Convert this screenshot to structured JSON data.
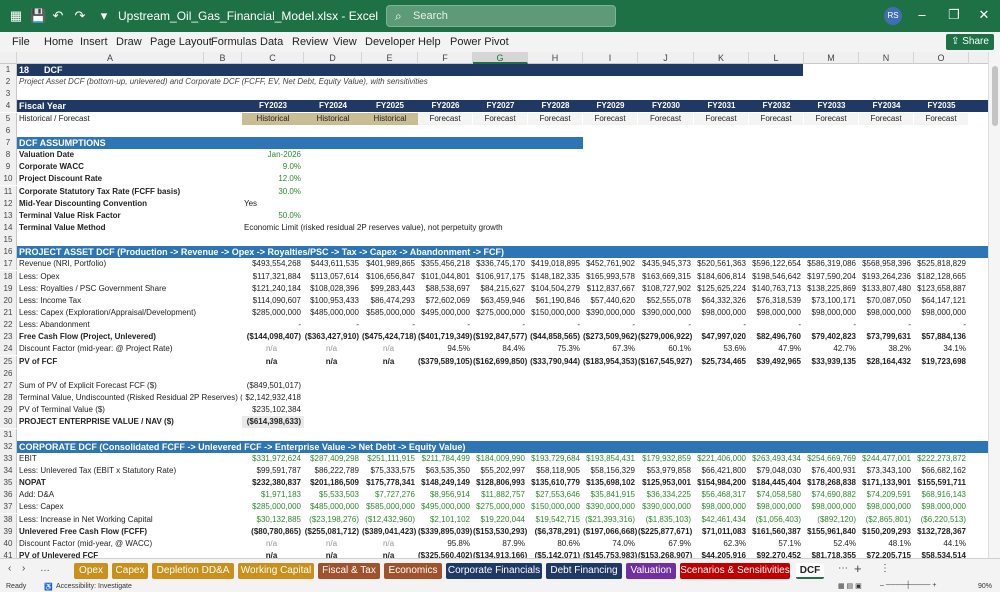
{
  "window": {
    "title": "Upstream_Oil_Gas_Financial_Model.xlsx - Excel",
    "search_placeholder": "Search",
    "avatar_initials": "RS",
    "accent": "#1e7145"
  },
  "menu": [
    "File",
    "Home",
    "Insert",
    "Draw",
    "Page Layout",
    "Formulas",
    "Data",
    "Review",
    "View",
    "Developer",
    "Help",
    "Power Pivot"
  ],
  "share_label": "Share",
  "columns": [
    "A",
    "B",
    "C",
    "D",
    "E",
    "F",
    "G",
    "H",
    "I",
    "J",
    "K",
    "L",
    "M",
    "N",
    "O"
  ],
  "sheet": {
    "title_num": "18",
    "title": "DCF",
    "subtitle": "Project Asset DCF (bottom-up, unlevered) and Corporate DCF (FCFF, EV, Net Debt, Equity Value), with sensitivities",
    "fiscal_year_label": "Fiscal Year",
    "hf_label": "Historical / Forecast",
    "years": [
      "FY2023",
      "FY2024",
      "FY2025",
      "FY2026",
      "FY2027",
      "FY2028",
      "FY2029",
      "FY2030",
      "FY2031",
      "FY2032",
      "FY2033",
      "FY2034",
      "FY2035"
    ],
    "hf": [
      "Historical",
      "Historical",
      "Historical",
      "Forecast",
      "Forecast",
      "Forecast",
      "Forecast",
      "Forecast",
      "Forecast",
      "Forecast",
      "Forecast",
      "Forecast",
      "Forecast"
    ],
    "assumptions_header": "DCF ASSUMPTIONS",
    "assumptions": [
      {
        "label": "Valuation Date",
        "value": "Jan-2026"
      },
      {
        "label": "Corporate WACC",
        "value": "9.0%"
      },
      {
        "label": "Project Discount Rate",
        "value": "12.0%"
      },
      {
        "label": "Corporate Statutory Tax Rate (FCFF basis)",
        "value": "30.0%"
      },
      {
        "label": "Mid-Year Discounting Convention",
        "value": "Yes"
      },
      {
        "label": "Terminal Value Risk Factor",
        "value": "50.0%"
      },
      {
        "label": "Terminal Value Method",
        "value": "Economic Limit (risked residual 2P reserves value), not perpetuity growth"
      }
    ],
    "project_header": "PROJECT ASSET DCF  (Production -> Revenue -> Opex -> Royalties/PSC -> Tax -> Capex -> Abandonment -> FCF)",
    "project_rows": [
      {
        "label": "Revenue (NRI, Portfolio)",
        "vals": [
          "$493,554,268",
          "$443,611,535",
          "$401,989,865",
          "$355,456,218",
          "$336,745,170",
          "$419,018,895",
          "$452,761,902",
          "$435,945,373",
          "$520,561,363",
          "$596,122,654",
          "$586,319,086",
          "$568,958,396",
          "$525,818,829"
        ],
        "bold": false
      },
      {
        "label": "Less: Opex",
        "vals": [
          "$117,321,884",
          "$113,057,614",
          "$106,656,847",
          "$101,044,801",
          "$106,917,175",
          "$148,182,335",
          "$165,993,578",
          "$163,669,315",
          "$184,606,814",
          "$198,546,642",
          "$197,590,204",
          "$193,264,236",
          "$182,128,665"
        ],
        "bold": false
      },
      {
        "label": "Less: Royalties / PSC Government Share",
        "vals": [
          "$121,240,184",
          "$108,028,396",
          "$99,283,443",
          "$88,538,697",
          "$84,215,627",
          "$104,504,279",
          "$112,837,667",
          "$108,727,902",
          "$125,625,224",
          "$140,763,713",
          "$138,225,869",
          "$133,807,480",
          "$123,658,887"
        ],
        "bold": false
      },
      {
        "label": "Less: Income Tax",
        "vals": [
          "$114,090,607",
          "$100,953,433",
          "$86,474,293",
          "$72,602,069",
          "$63,459,946",
          "$61,190,846",
          "$57,440,620",
          "$52,555,078",
          "$64,332,326",
          "$76,318,539",
          "$73,100,171",
          "$70,087,050",
          "$64,147,121"
        ],
        "bold": false
      },
      {
        "label": "Less: Capex (Exploration/Appraisal/Development)",
        "vals": [
          "$285,000,000",
          "$485,000,000",
          "$585,000,000",
          "$495,000,000",
          "$275,000,000",
          "$150,000,000",
          "$390,000,000",
          "$390,000,000",
          "$98,000,000",
          "$98,000,000",
          "$98,000,000",
          "$98,000,000",
          "$98,000,000"
        ],
        "bold": false
      },
      {
        "label": "Less: Abandonment",
        "vals": [
          "-",
          "-",
          "-",
          "-",
          "-",
          "-",
          "-",
          "-",
          "-",
          "-",
          "-",
          "-",
          "-"
        ],
        "bold": false
      },
      {
        "label": "Free Cash Flow (Project, Unlevered)",
        "vals": [
          "($144,098,407)",
          "($363,427,910)",
          "($475,424,718)",
          "($401,719,349)",
          "($192,847,577)",
          "($44,858,565)",
          "($273,509,962)",
          "($279,006,922)",
          "$47,997,020",
          "$82,496,760",
          "$79,402,823",
          "$73,799,631",
          "$57,884,136"
        ],
        "bold": true
      },
      {
        "label": "Discount Factor (mid-year: @ Project Rate)",
        "vals": [
          "n/a",
          "n/a",
          "n/a",
          "94.5%",
          "84.4%",
          "75.3%",
          "67.3%",
          "60.1%",
          "53.6%",
          "47.9%",
          "42.7%",
          "38.2%",
          "34.1%"
        ],
        "bold": false
      },
      {
        "label": "PV of FCF",
        "vals": [
          "n/a",
          "n/a",
          "n/a",
          "($379,589,105)",
          "($162,699,850)",
          "($33,790,944)",
          "($183,954,353)",
          "($167,545,927)",
          "$25,734,465",
          "$39,492,965",
          "$33,939,135",
          "$28,164,432",
          "$19,723,698"
        ],
        "bold": true
      }
    ],
    "summary": [
      {
        "label": "Sum of PV of Explicit Forecast FCF ($)",
        "value": "($849,501,017)",
        "bold": false
      },
      {
        "label": "Terminal Value, Undiscounted (Risked Residual 2P Reserves) ($)",
        "value": "$2,142,932,418",
        "bold": false
      },
      {
        "label": "PV of Terminal Value ($)",
        "value": "$235,102,384",
        "bold": false
      },
      {
        "label": "PROJECT ENTERPRISE VALUE / NAV ($)",
        "value": "($614,398,633)",
        "bold": true
      }
    ],
    "corporate_header": "CORPORATE DCF  (Consolidated FCFF -> Unlevered FCF -> Enterprise Value -> Net Debt -> Equity Value)",
    "corporate_rows": [
      {
        "label": "EBIT",
        "vals": [
          "$331,972,624",
          "$287,409,298",
          "$251,111,915",
          "$211,784,499",
          "$184,009,990",
          "$193,729,684",
          "$193,854,431",
          "$179,932,859",
          "$221,406,000",
          "$263,493,434",
          "$254,669,769",
          "$244,477,001",
          "$222,273,872"
        ],
        "bold": false,
        "green": true
      },
      {
        "label": "Less: Unlevered Tax (EBIT x Statutory Rate)",
        "vals": [
          "$99,591,787",
          "$86,222,789",
          "$75,333,575",
          "$63,535,350",
          "$55,202,997",
          "$58,118,905",
          "$58,156,329",
          "$53,979,858",
          "$66,421,800",
          "$79,048,030",
          "$76,400,931",
          "$73,343,100",
          "$66,682,162"
        ],
        "bold": false,
        "green": false
      },
      {
        "label": "NOPAT",
        "vals": [
          "$232,380,837",
          "$201,186,509",
          "$175,778,341",
          "$148,249,149",
          "$128,806,993",
          "$135,610,779",
          "$135,698,102",
          "$125,953,001",
          "$154,984,200",
          "$184,445,404",
          "$178,268,838",
          "$171,133,901",
          "$155,591,711"
        ],
        "bold": true,
        "green": false
      },
      {
        "label": "Add: D&A",
        "vals": [
          "$1,971,183",
          "$5,533,503",
          "$7,727,276",
          "$8,956,914",
          "$11,882,757",
          "$27,553,646",
          "$35,841,915",
          "$36,334,225",
          "$56,468,317",
          "$74,058,580",
          "$74,690,882",
          "$74,209,591",
          "$68,916,143"
        ],
        "bold": false,
        "green": true
      },
      {
        "label": "Less: Capex",
        "vals": [
          "$285,000,000",
          "$485,000,000",
          "$585,000,000",
          "$495,000,000",
          "$275,000,000",
          "$150,000,000",
          "$390,000,000",
          "$390,000,000",
          "$98,000,000",
          "$98,000,000",
          "$98,000,000",
          "$98,000,000",
          "$98,000,000"
        ],
        "bold": false,
        "green": true
      },
      {
        "label": "Less: Increase in Net Working Capital",
        "vals": [
          "$30,132,885",
          "($23,198,276)",
          "($12,432,960)",
          "$2,101,102",
          "$19,220,044",
          "$19,542,715",
          "($21,393,316)",
          "($1,835,103)",
          "$42,461,434",
          "($1,056,403)",
          "($892,120)",
          "($2,865,801)",
          "($6,220,513)"
        ],
        "bold": false,
        "green": true
      },
      {
        "label": "Unlevered Free Cash Flow (FCFF)",
        "vals": [
          "($80,780,865)",
          "($255,081,712)",
          "($389,041,423)",
          "($339,895,039)",
          "($153,530,293)",
          "($6,378,291)",
          "($197,066,668)",
          "($225,877,671)",
          "$71,011,083",
          "$161,560,387",
          "$155,961,840",
          "$150,209,293",
          "$132,728,367"
        ],
        "bold": true,
        "green": false
      },
      {
        "label": "Discount Factor (mid-year, @ WACC)",
        "vals": [
          "n/a",
          "n/a",
          "n/a",
          "95.8%",
          "87.9%",
          "80.6%",
          "74.0%",
          "67.9%",
          "62.3%",
          "57.1%",
          "52.4%",
          "48.1%",
          "44.1%"
        ],
        "bold": false,
        "green": false
      },
      {
        "label": "PV of Unlevered FCF",
        "vals": [
          "n/a",
          "n/a",
          "n/a",
          "($325,560,402)",
          "($134,913,166)",
          "($5,142,071)",
          "($145,753,983)",
          "($153,268,907)",
          "$44,205,916",
          "$92,270,452",
          "$81,718,355",
          "$72,205,715",
          "$58,534,514"
        ],
        "bold": true,
        "green": false
      }
    ]
  },
  "tabs": [
    {
      "label": "Opex",
      "color": "#c9901c"
    },
    {
      "label": "Capex",
      "color": "#c9901c"
    },
    {
      "label": "Depletion DD&A",
      "color": "#c9901c"
    },
    {
      "label": "Working Capital",
      "color": "#c9901c"
    },
    {
      "label": "Fiscal & Tax",
      "color": "#a0522d"
    },
    {
      "label": "Economics",
      "color": "#a0522d"
    },
    {
      "label": "Corporate Financials",
      "color": "#1f3864"
    },
    {
      "label": "Debt Financing",
      "color": "#1f3864"
    },
    {
      "label": "Valuation",
      "color": "#7030a0"
    },
    {
      "label": "Scenarios & Sensitivities",
      "color": "#c00000"
    },
    {
      "label": "DCF",
      "color": "#ffffff"
    }
  ],
  "status": {
    "ready": "Ready",
    "accessibility": "Accessibility: Investigate",
    "zoom": "90%"
  }
}
